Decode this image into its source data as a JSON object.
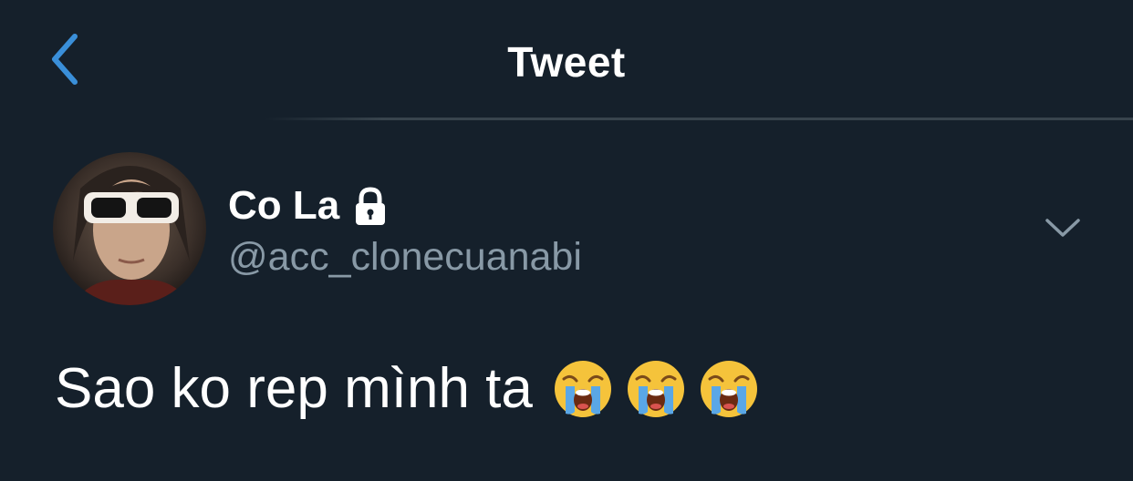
{
  "header": {
    "title": "Tweet",
    "back_icon": "chevron-left-icon"
  },
  "author": {
    "display_name": "Co La",
    "handle": "@acc_clonecuanabi",
    "protected_icon": "lock-icon",
    "menu_icon": "chevron-down-icon"
  },
  "tweet": {
    "text": "Sao ko rep mình ta",
    "emojis": [
      "loudly-crying-face-emoji",
      "loudly-crying-face-emoji",
      "loudly-crying-face-emoji"
    ]
  },
  "colors": {
    "background": "#15202b",
    "accent": "#1da1f2",
    "secondary_text": "#8899a6",
    "divider": "#38444d"
  }
}
